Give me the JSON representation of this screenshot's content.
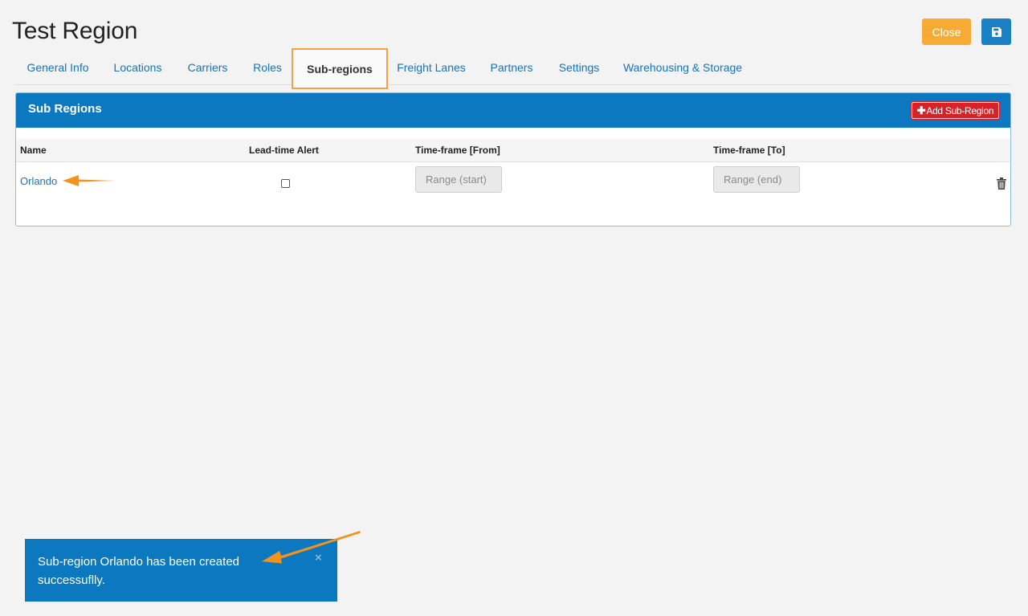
{
  "page": {
    "title": "Test Region"
  },
  "header": {
    "close_label": "Close",
    "save_icon": "floppy-disk-icon"
  },
  "tabs": [
    {
      "label": "General Info",
      "active": false
    },
    {
      "label": "Locations",
      "active": false
    },
    {
      "label": "Carriers",
      "active": false
    },
    {
      "label": "Roles",
      "active": false
    },
    {
      "label": "Sub-regions",
      "active": true
    },
    {
      "label": "Freight Lanes",
      "active": false
    },
    {
      "label": "Partners",
      "active": false
    },
    {
      "label": "Settings",
      "active": false
    },
    {
      "label": "Warehousing & Storage",
      "active": false
    }
  ],
  "panel": {
    "title": "Sub Regions",
    "add_label": "Add Sub-Region",
    "columns": {
      "name": "Name",
      "lead_time": "Lead-time Alert",
      "from": "Time-frame [From]",
      "to": "Time-frame [To]"
    },
    "rows": [
      {
        "name": "Orlando",
        "lead_time_alert": false,
        "from_placeholder": "Range (start)",
        "to_placeholder": "Range (end)"
      }
    ]
  },
  "toast": {
    "message": "Sub-region Orlando has been created successuflly.",
    "close_symbol": "×"
  },
  "colors": {
    "primary": "#0b78bf",
    "close_button": "#f6ac34",
    "add_button": "#d4242a",
    "active_tab_border": "#f5a04a",
    "annotation_arrow": "#f4921e"
  }
}
